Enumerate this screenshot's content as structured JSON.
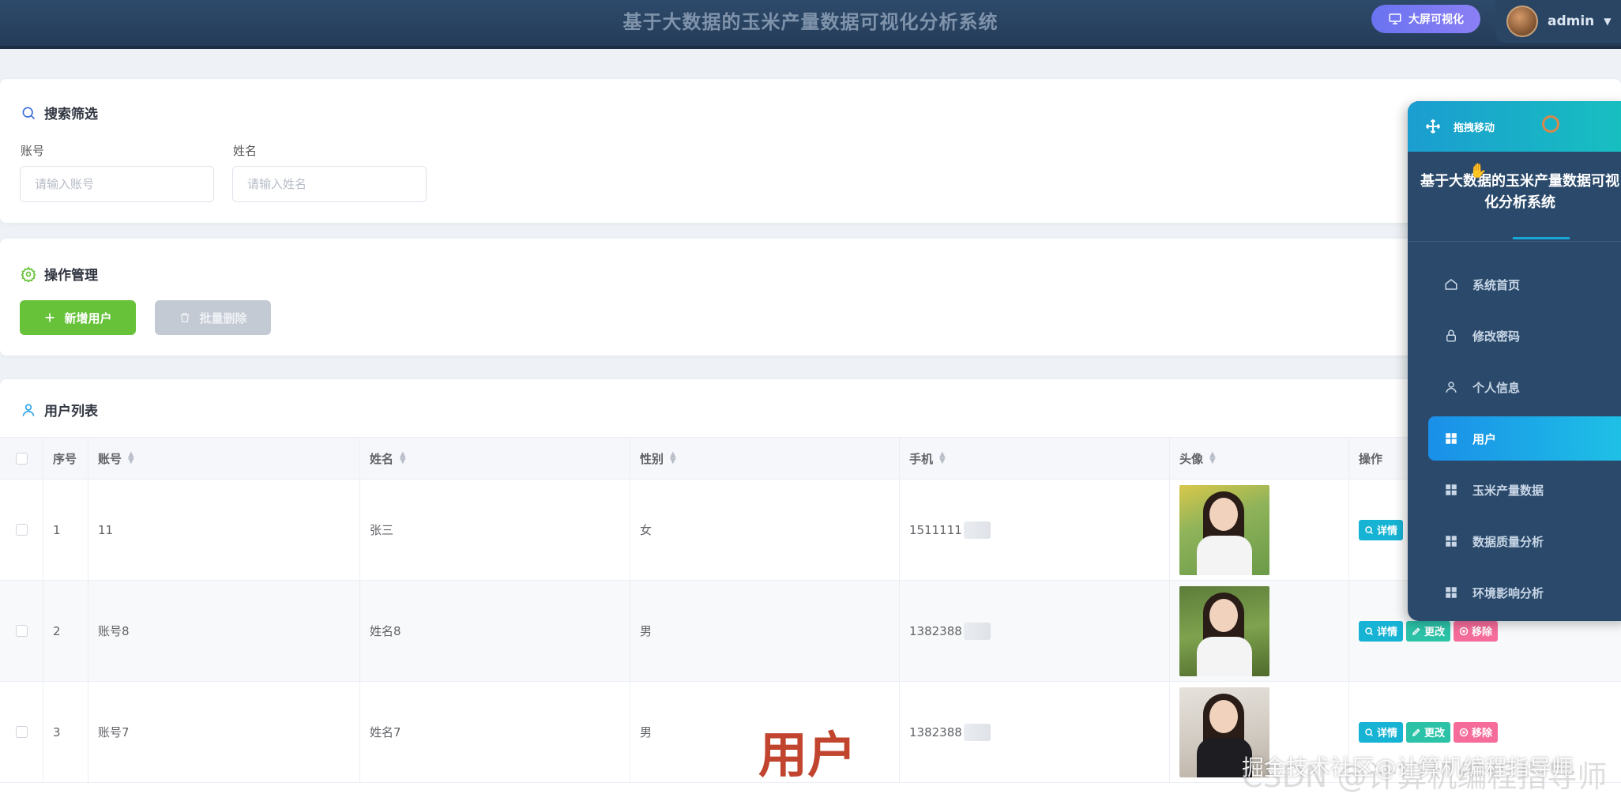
{
  "header": {
    "title": "基于大数据的玉米产量数据可视化分析系统",
    "bigscreen_label": "大屏可视化",
    "user_name": "admin"
  },
  "search": {
    "title": "搜索筛选",
    "account_label": "账号",
    "account_placeholder": "请输入账号",
    "name_label": "姓名",
    "name_placeholder": "请输入姓名"
  },
  "operations": {
    "title": "操作管理",
    "add_label": "新增用户",
    "batch_delete_label": "批量删除"
  },
  "user_list": {
    "title": "用户列表",
    "columns": [
      "序号",
      "账号",
      "姓名",
      "性别",
      "手机",
      "头像",
      "操作"
    ],
    "rows": [
      {
        "no": "1",
        "account": "11",
        "name": "张三",
        "gender": "女",
        "phone": "1511111"
      },
      {
        "no": "2",
        "account": "账号8",
        "name": "姓名8",
        "gender": "男",
        "phone": "1382388"
      },
      {
        "no": "3",
        "account": "账号7",
        "name": "姓名7",
        "gender": "男",
        "phone": "1382388"
      }
    ],
    "actions": {
      "detail": "详情",
      "edit": "更改",
      "remove": "移除"
    }
  },
  "float_panel": {
    "drag_label": "拖拽移动",
    "title": "基于大数据的玉米产量数据可视化分析系统",
    "menu": [
      {
        "label": "系统首页",
        "icon": "home-icon",
        "active": false
      },
      {
        "label": "修改密码",
        "icon": "lock-icon",
        "active": false
      },
      {
        "label": "个人信息",
        "icon": "user-icon",
        "active": false
      },
      {
        "label": "用户",
        "icon": "grid-icon",
        "active": true
      },
      {
        "label": "玉米产量数据",
        "icon": "grid-icon",
        "active": false
      },
      {
        "label": "数据质量分析",
        "icon": "grid-icon",
        "active": false
      },
      {
        "label": "环境影响分析",
        "icon": "grid-icon",
        "active": false
      }
    ]
  },
  "overlay": {
    "page_label": "用户",
    "watermark": "掘金技术社区@计算机编程指导师",
    "watermark_ghost": "CSDN @计算机编程指导师"
  },
  "colors": {
    "header_bg": "#2e4a6b",
    "accent_green": "#67c23a",
    "accent_blue": "#1a8fe8",
    "detail_btn": "#17b3d4",
    "edit_btn": "#2bc2a8",
    "remove_btn": "#f56c9a"
  }
}
